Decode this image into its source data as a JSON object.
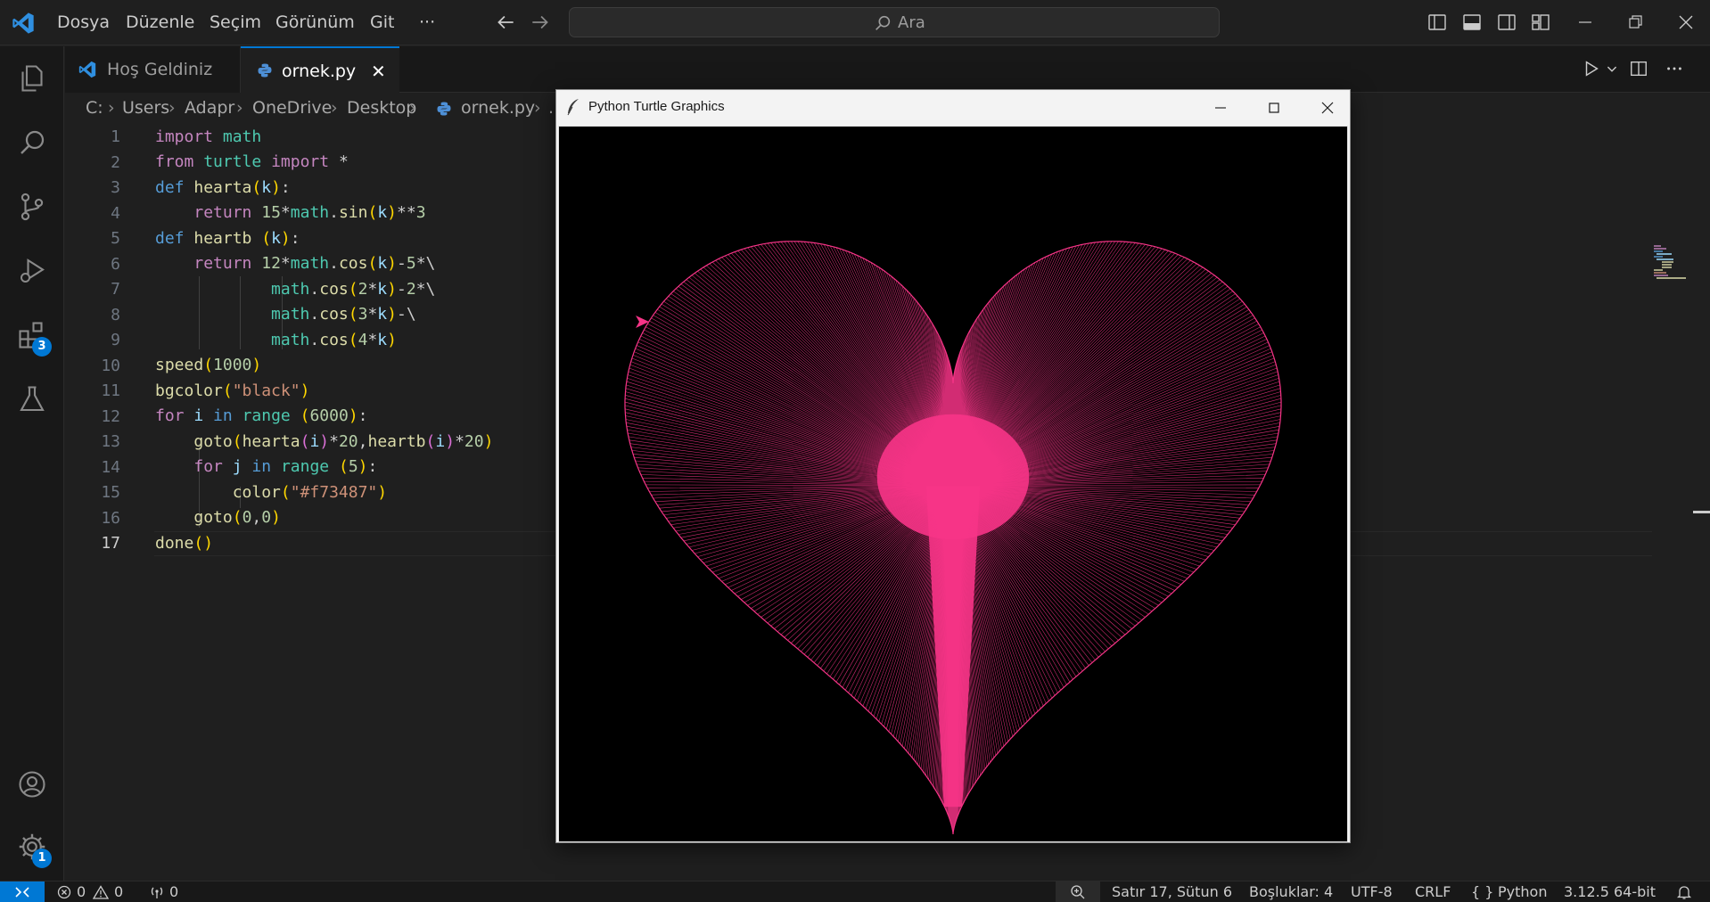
{
  "menu": [
    "Dosya",
    "Düzenle",
    "Seçim",
    "Görünüm",
    "Git",
    "···"
  ],
  "search": {
    "placeholder": "Ara"
  },
  "activity": {
    "extensions_badge": "3",
    "settings_badge": "1"
  },
  "tabs": [
    {
      "label": "Hoş Geldiniz",
      "icon": "vscode-logo-icon"
    },
    {
      "label": "ornek.py",
      "icon": "python-icon",
      "close": "✕"
    }
  ],
  "breadcrumb": [
    "C:",
    "Users",
    "Adapr",
    "OneDrive",
    "Desktop",
    "ornek.py",
    "..."
  ],
  "code": {
    "line_numbers": [
      "1",
      "2",
      "3",
      "4",
      "5",
      "6",
      "7",
      "8",
      "9",
      "10",
      "11",
      "12",
      "13",
      "14",
      "15",
      "16",
      "17"
    ],
    "active_line": "17"
  },
  "turtle_window": {
    "title": "Python Turtle Graphics",
    "canvas_bg": "#000000",
    "pen_color": "#f73487"
  },
  "status": {
    "errors": "0",
    "warnings": "0",
    "ports": "0",
    "position": "Satır 17, Sütun 6",
    "spaces": "Boşluklar: 4",
    "encoding": "UTF-8",
    "eol": "CRLF",
    "language": "Python",
    "interpreter": "3.12.5 64-bit"
  },
  "colors": {
    "accent": "#0078d4",
    "editor_bg": "#1f1f1f",
    "sidebar_bg": "#181818"
  }
}
